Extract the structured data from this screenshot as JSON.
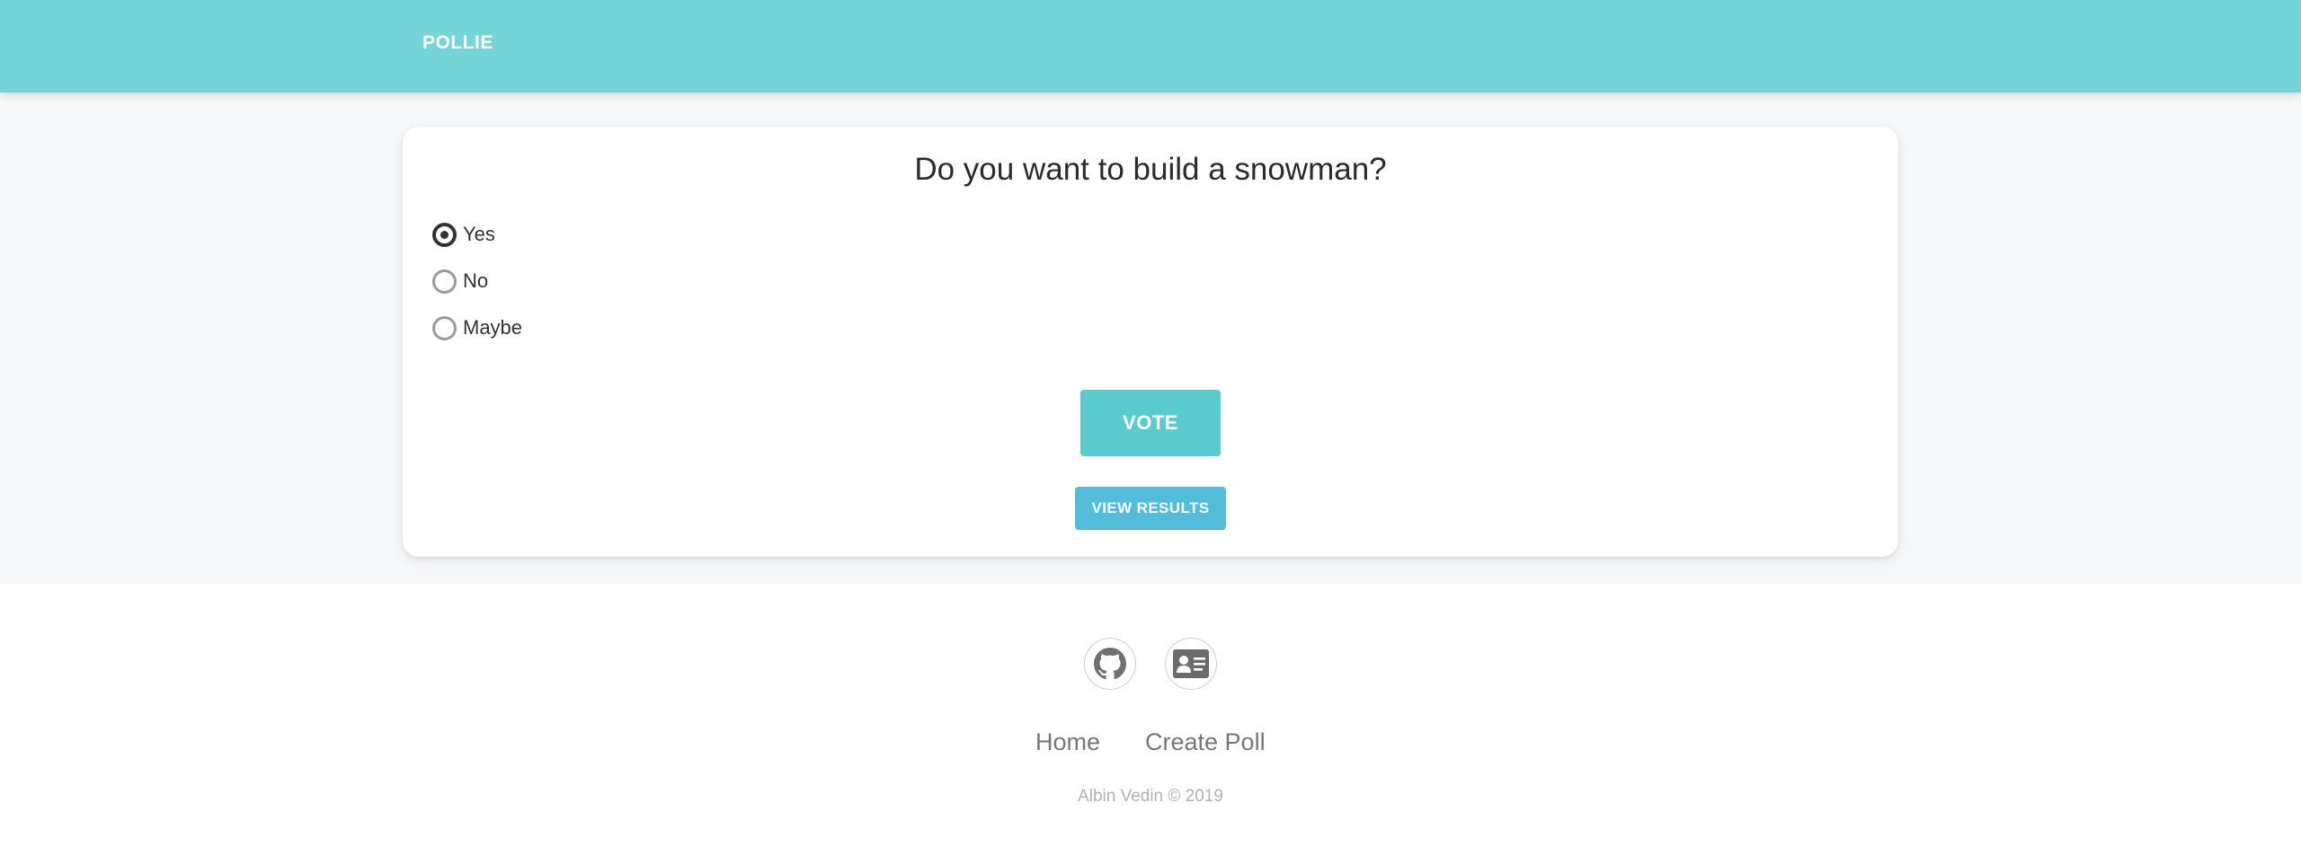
{
  "navbar": {
    "brand": "POLLIE",
    "background_color": "#73d5d8"
  },
  "poll": {
    "question": "Do you want to build a snowman?",
    "options": [
      {
        "label": "Yes",
        "selected": true
      },
      {
        "label": "No",
        "selected": false
      },
      {
        "label": "Maybe",
        "selected": false
      }
    ],
    "vote_label": "VOTE",
    "view_results_label": "VIEW RESULTS",
    "vote_color": "#5acccd",
    "results_color": "#53bcda"
  },
  "footer": {
    "icons": [
      "github-icon",
      "contact-card-icon"
    ],
    "links": [
      "Home",
      "Create Poll"
    ],
    "copyright": "Albin Vedin © 2019"
  }
}
